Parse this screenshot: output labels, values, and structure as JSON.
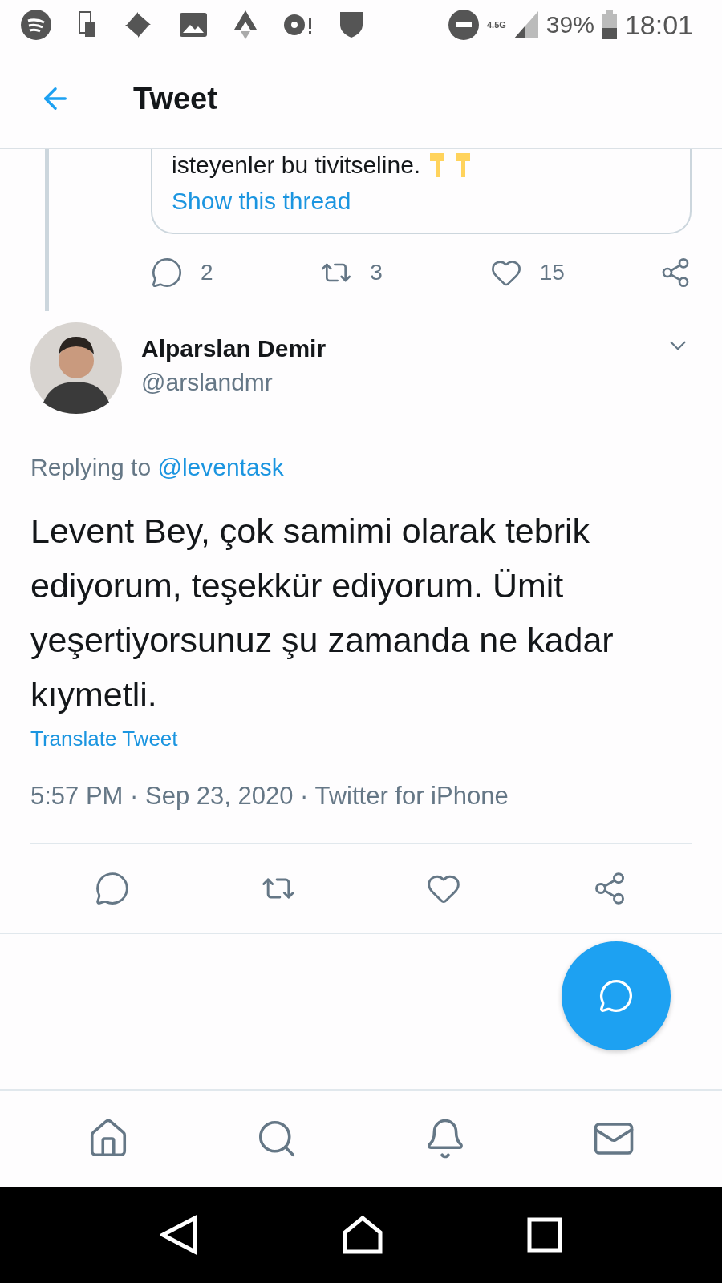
{
  "status_bar": {
    "network": "4.5G",
    "battery": "39%",
    "time": "18:01"
  },
  "header": {
    "title": "Tweet"
  },
  "quoted_tweet": {
    "text": "isteyenler bu tivitseline.",
    "link": "Show this thread"
  },
  "parent_actions": {
    "replies": "2",
    "retweets": "3",
    "likes": "15"
  },
  "tweet": {
    "name": "Alparslan Demir",
    "handle": "@arslandmr",
    "replying_label": "Replying to",
    "replying_to": "@leventask",
    "text": "Levent Bey, çok samimi olarak tebrik ediyorum, teşekkür ediyorum. Ümit yeşertiyorsunuz şu zamanda ne kadar kıymetli.",
    "translate": "Translate Tweet",
    "meta": "5:57 PM · Sep 23, 2020 · Twitter for iPhone"
  }
}
